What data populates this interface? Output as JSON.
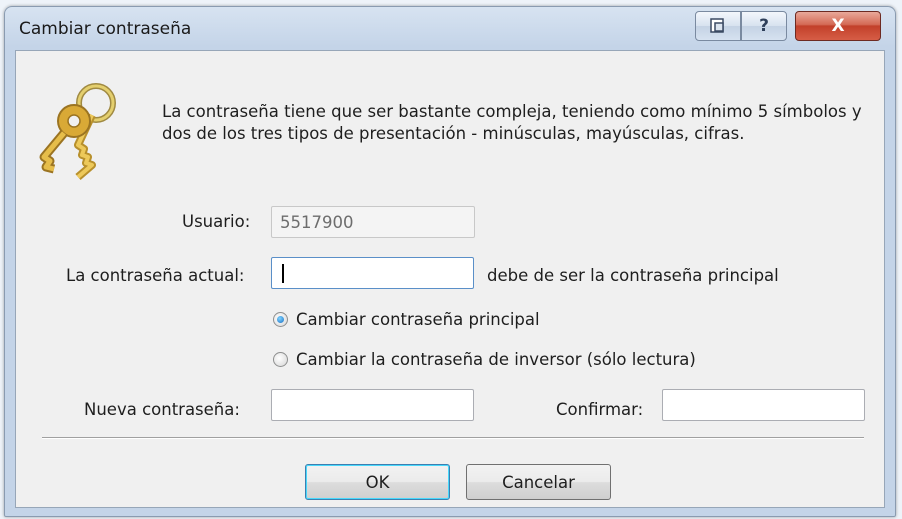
{
  "window": {
    "title": "Cambiar contraseña"
  },
  "titlebar": {
    "help_label": "?",
    "close_label": "X"
  },
  "info_text": "La contraseña tiene que ser bastante compleja, teniendo como mínimo 5 símbolos y dos de los tres tipos de presentación - minúsculas, mayúsculas, cifras.",
  "user": {
    "label": "Usuario:",
    "value": "5517900"
  },
  "current_password": {
    "label": "La contraseña actual:",
    "value": "",
    "hint": "debe de ser la contraseña principal"
  },
  "options": [
    {
      "label": "Cambiar contraseña principal",
      "checked": true
    },
    {
      "label": "Cambiar la contraseña de inversor (sólo lectura)",
      "checked": false
    }
  ],
  "new_password": {
    "label": "Nueva contraseña:",
    "value": ""
  },
  "confirm": {
    "label": "Confirmar:",
    "value": ""
  },
  "buttons": {
    "ok": "OK",
    "cancel": "Cancelar"
  }
}
